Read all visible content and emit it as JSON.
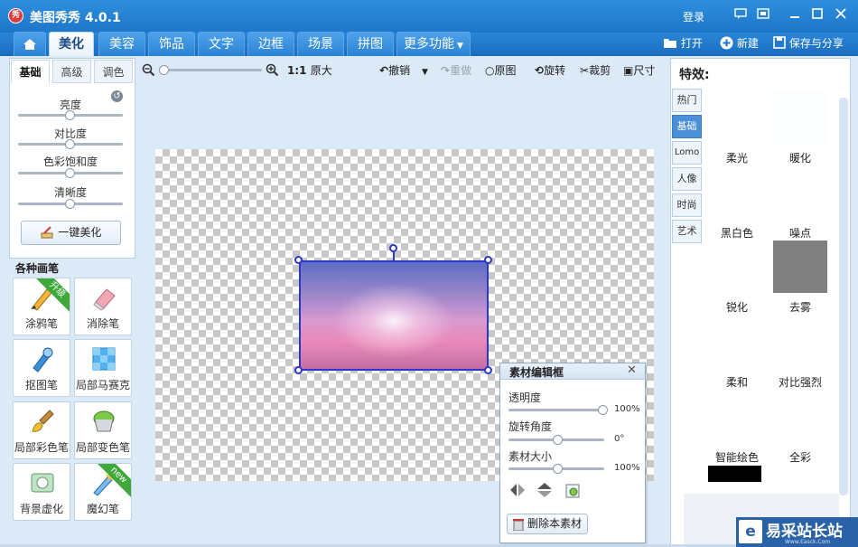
{
  "app": {
    "title": "美图秀秀 4.0.1",
    "login": "登录",
    "logo_char": "秀"
  },
  "tabs": [
    "美化",
    "美容",
    "饰品",
    "文字",
    "边框",
    "场景",
    "拼图",
    "更多功能"
  ],
  "nav_actions": {
    "open": "打开",
    "new": "新建",
    "save_share": "保存与分享"
  },
  "left": {
    "subtabs": [
      "基础",
      "高级",
      "调色"
    ],
    "adjustments": [
      {
        "label": "亮度",
        "value": 0.5
      },
      {
        "label": "对比度",
        "value": 0.5
      },
      {
        "label": "色彩饱和度",
        "value": 0.5
      },
      {
        "label": "清晰度",
        "value": 0.5
      }
    ],
    "one_click": "一键美化",
    "brushes_title": "各种画笔",
    "brushes": [
      {
        "label": "涂鸦笔",
        "badge": "升级"
      },
      {
        "label": "消除笔",
        "badge": ""
      },
      {
        "label": "抠图笔",
        "badge": ""
      },
      {
        "label": "局部马赛克",
        "badge": ""
      },
      {
        "label": "局部彩色笔",
        "badge": ""
      },
      {
        "label": "局部变色笔",
        "badge": ""
      },
      {
        "label": "背景虚化",
        "badge": ""
      },
      {
        "label": "魔幻笔",
        "badge": "new"
      }
    ]
  },
  "toolbar": {
    "zoom_ratio": "1:1",
    "original_size": "原大",
    "undo": "撤销",
    "redo": "重做",
    "original": "原图",
    "rotate": "旋转",
    "crop": "裁剪",
    "resize": "尺寸",
    "zoom_level": 0.0
  },
  "editor": {
    "title": "素材编辑框",
    "rows": [
      {
        "label": "透明度",
        "value": "100%",
        "level": 1.0
      },
      {
        "label": "旋转角度",
        "value": "0°",
        "level": 0.5
      },
      {
        "label": "素材大小",
        "value": "100%",
        "level": 0.5
      }
    ],
    "delete": "删除本素材"
  },
  "right": {
    "title": "特效:",
    "categories": [
      "热门",
      "基础",
      "Lomo",
      "人像",
      "时尚",
      "艺术"
    ],
    "active_category": "基础",
    "effects": [
      "柔光",
      "暖化",
      "黑白色",
      "噪点",
      "锐化",
      "去雾",
      "柔和",
      "对比强烈",
      "智能绘色",
      "全彩"
    ]
  },
  "watermark": {
    "name": "易采站长站",
    "url": "Www.Easck.Com"
  },
  "colors": {
    "title_bar": "#1d76c9",
    "selection": "#2e36c8",
    "badge_green": "#3fa83a"
  }
}
